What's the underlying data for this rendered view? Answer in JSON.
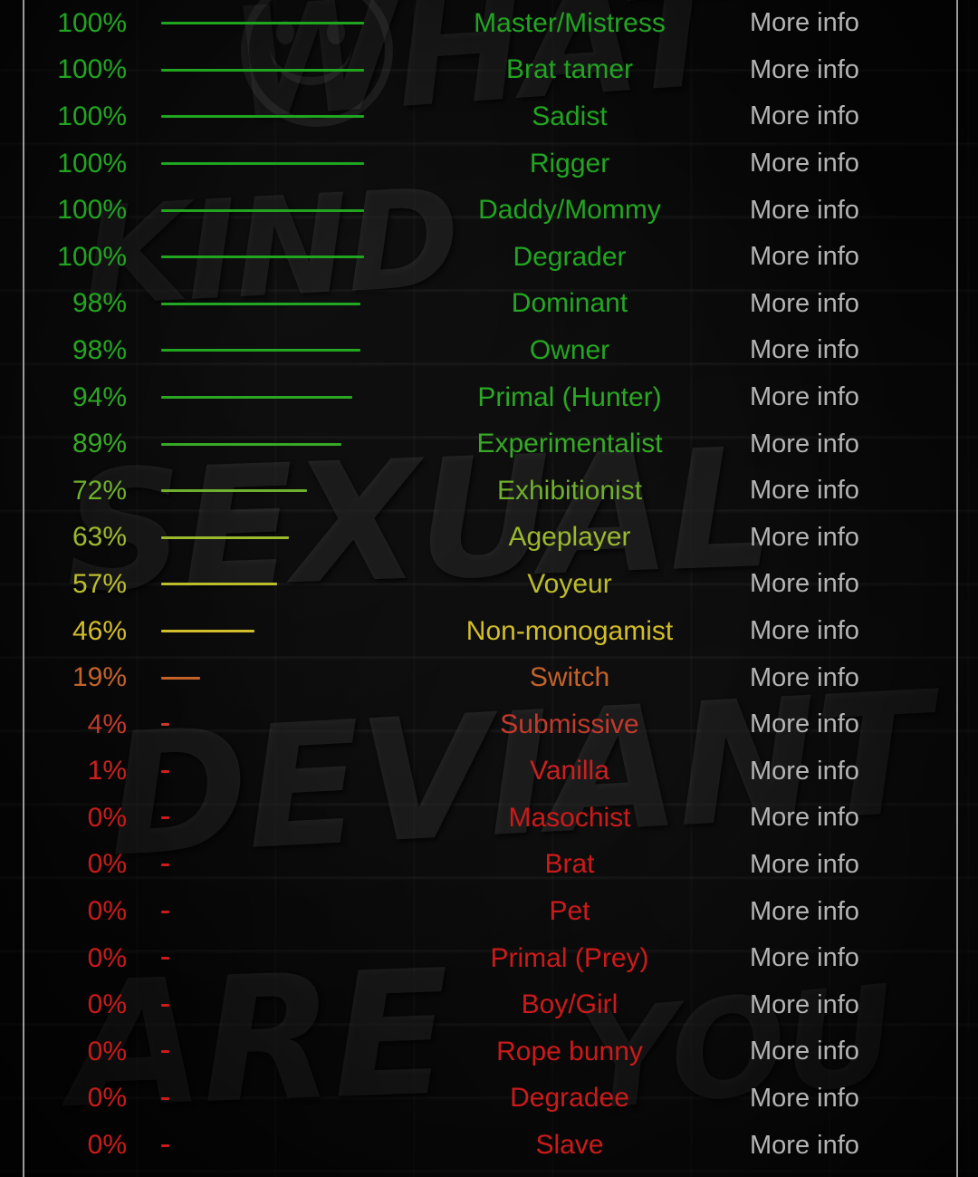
{
  "background": {
    "graffiti_lines": [
      "WHAT",
      "KIND",
      "SEXUAL",
      "DEVIANT",
      "ARE",
      "YOU"
    ],
    "smiley_icon": "smiley-face-graffiti"
  },
  "colors": {
    "full_green": "#21a521",
    "mid_green": "#5aac28",
    "yellow_green": "#a8b62e",
    "yellow": "#d4c028",
    "orange": "#c4622a",
    "red_orange": "#c03a2e",
    "red": "#cc1a1a",
    "more_info": "#b4b4b4",
    "frame": "#9a9a9a",
    "background": "#050505"
  },
  "table": {
    "more_info_label": "More info",
    "zero_bar_glyph": "-",
    "rows": [
      {
        "percent": "100%",
        "value": 100,
        "label": "Master/Mistress",
        "color": "#21a521",
        "more_info": "More info"
      },
      {
        "percent": "100%",
        "value": 100,
        "label": "Brat tamer",
        "color": "#21a521",
        "more_info": "More info"
      },
      {
        "percent": "100%",
        "value": 100,
        "label": "Sadist",
        "color": "#21a521",
        "more_info": "More info"
      },
      {
        "percent": "100%",
        "value": 100,
        "label": "Rigger",
        "color": "#21a521",
        "more_info": "More info"
      },
      {
        "percent": "100%",
        "value": 100,
        "label": "Daddy/Mommy",
        "color": "#21a521",
        "more_info": "More info"
      },
      {
        "percent": "100%",
        "value": 100,
        "label": "Degrader",
        "color": "#21a521",
        "more_info": "More info"
      },
      {
        "percent": "98%",
        "value": 98,
        "label": "Dominant",
        "color": "#23a621",
        "more_info": "More info"
      },
      {
        "percent": "98%",
        "value": 98,
        "label": "Owner",
        "color": "#23a621",
        "more_info": "More info"
      },
      {
        "percent": "94%",
        "value": 94,
        "label": "Primal (Hunter)",
        "color": "#2ba724",
        "more_info": "More info"
      },
      {
        "percent": "89%",
        "value": 89,
        "label": "Experimentalist",
        "color": "#36a926",
        "more_info": "More info"
      },
      {
        "percent": "72%",
        "value": 72,
        "label": "Exhibitionist",
        "color": "#6fb02c",
        "more_info": "More info"
      },
      {
        "percent": "63%",
        "value": 63,
        "label": "Ageplayer",
        "color": "#9cb92e",
        "more_info": "More info"
      },
      {
        "percent": "57%",
        "value": 57,
        "label": "Voyeur",
        "color": "#bcbd2d",
        "more_info": "More info"
      },
      {
        "percent": "46%",
        "value": 46,
        "label": "Non-monogamist",
        "color": "#d2bd2a",
        "more_info": "More info"
      },
      {
        "percent": "19%",
        "value": 19,
        "label": "Switch",
        "color": "#c4622a",
        "more_info": "More info"
      },
      {
        "percent": "4%",
        "value": 4,
        "label": "Submissive",
        "color": "#c23a2c",
        "more_info": "More info"
      },
      {
        "percent": "1%",
        "value": 1,
        "label": "Vanilla",
        "color": "#cb2020",
        "more_info": "More info"
      },
      {
        "percent": "0%",
        "value": 0,
        "label": "Masochist",
        "color": "#cc1a1a",
        "more_info": "More info"
      },
      {
        "percent": "0%",
        "value": 0,
        "label": "Brat",
        "color": "#cc1a1a",
        "more_info": "More info"
      },
      {
        "percent": "0%",
        "value": 0,
        "label": "Pet",
        "color": "#cc1a1a",
        "more_info": "More info"
      },
      {
        "percent": "0%",
        "value": 0,
        "label": "Primal (Prey)",
        "color": "#cc1a1a",
        "more_info": "More info"
      },
      {
        "percent": "0%",
        "value": 0,
        "label": "Boy/Girl",
        "color": "#cc1a1a",
        "more_info": "More info"
      },
      {
        "percent": "0%",
        "value": 0,
        "label": "Rope bunny",
        "color": "#cc1a1a",
        "more_info": "More info"
      },
      {
        "percent": "0%",
        "value": 0,
        "label": "Degradee",
        "color": "#cc1a1a",
        "more_info": "More info"
      },
      {
        "percent": "0%",
        "value": 0,
        "label": "Slave",
        "color": "#cc1a1a",
        "more_info": "More info"
      }
    ]
  },
  "chart_data": {
    "type": "bar",
    "title": "",
    "xlabel": "",
    "ylabel": "",
    "xlim": [
      0,
      100
    ],
    "orientation": "horizontal",
    "grid": false,
    "legend": "none",
    "categories": [
      "Master/Mistress",
      "Brat tamer",
      "Sadist",
      "Rigger",
      "Daddy/Mommy",
      "Degrader",
      "Dominant",
      "Owner",
      "Primal (Hunter)",
      "Experimentalist",
      "Exhibitionist",
      "Ageplayer",
      "Voyeur",
      "Non-monogamist",
      "Switch",
      "Submissive",
      "Vanilla",
      "Masochist",
      "Brat",
      "Pet",
      "Primal (Prey)",
      "Boy/Girl",
      "Rope bunny",
      "Degradee",
      "Slave"
    ],
    "values": [
      100,
      100,
      100,
      100,
      100,
      100,
      98,
      98,
      94,
      89,
      72,
      63,
      57,
      46,
      19,
      4,
      1,
      0,
      0,
      0,
      0,
      0,
      0,
      0,
      0
    ],
    "tick_labels": [
      "100%",
      "100%",
      "100%",
      "100%",
      "100%",
      "100%",
      "98%",
      "98%",
      "94%",
      "89%",
      "72%",
      "63%",
      "57%",
      "46%",
      "19%",
      "4%",
      "1%",
      "0%",
      "0%",
      "0%",
      "0%",
      "0%",
      "0%",
      "0%",
      "0%"
    ],
    "colors": [
      "#21a521",
      "#21a521",
      "#21a521",
      "#21a521",
      "#21a521",
      "#21a521",
      "#23a621",
      "#23a621",
      "#2ba724",
      "#36a926",
      "#6fb02c",
      "#9cb92e",
      "#bcbd2d",
      "#d2bd2a",
      "#c4622a",
      "#c23a2c",
      "#cb2020",
      "#cc1a1a",
      "#cc1a1a",
      "#cc1a1a",
      "#cc1a1a",
      "#cc1a1a",
      "#cc1a1a",
      "#cc1a1a",
      "#cc1a1a"
    ]
  }
}
